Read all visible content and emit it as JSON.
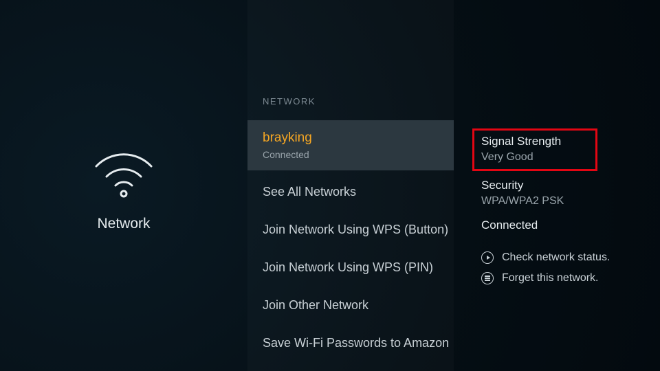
{
  "left": {
    "label": "Network"
  },
  "middle": {
    "section_header": "NETWORK",
    "connected_network": {
      "ssid": "brayking",
      "status": "Connected"
    },
    "options": [
      "See All Networks",
      "Join Network Using WPS (Button)",
      "Join Network Using WPS (PIN)",
      "Join Other Network",
      "Save Wi-Fi Passwords to Amazon"
    ]
  },
  "right": {
    "signal_label": "Signal Strength",
    "signal_value": "Very Good",
    "security_label": "Security",
    "security_value": "WPA/WPA2 PSK",
    "status": "Connected",
    "action_check": "Check network status.",
    "action_forget": "Forget this network."
  }
}
